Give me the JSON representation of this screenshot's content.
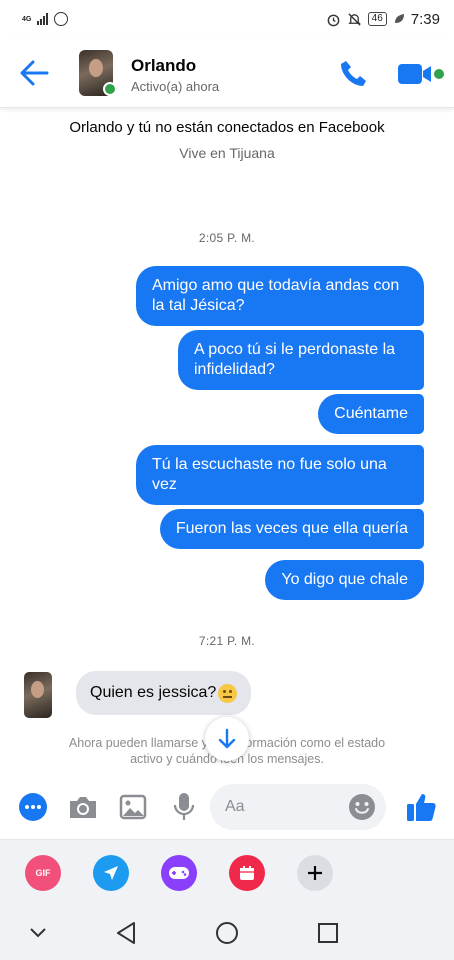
{
  "status_bar": {
    "network": "4G",
    "battery": "46",
    "time": "7:39"
  },
  "header": {
    "contact_name": "Orlando",
    "contact_status": "Activo(a) ahora"
  },
  "conversation": {
    "notice": "Orlando y tú no están conectados en Facebook",
    "lives_in": "Vive en Tijuana",
    "timestamp_1": "2:05 P. M.",
    "timestamp_2": "7:21 P. M.",
    "outgoing": [
      "Amigo amo que todavía andas con la tal Jésica?",
      "A poco tú si le perdonaste la infidelidad?",
      "Cuéntame",
      "Tú la escuchaste no fue solo una vez",
      "Fueron las veces que ella quería",
      "Yo digo que chale"
    ],
    "incoming": [
      "Quien es jessica?"
    ],
    "info_text": "Ahora pueden llamarse y ver información como el estado activo y cuándo leen los mensajes."
  },
  "composer": {
    "placeholder": "Aa"
  },
  "extras": {
    "gif_label": "GIF"
  },
  "icons": {
    "accent": "#1877f2",
    "online": "#31a24c"
  }
}
